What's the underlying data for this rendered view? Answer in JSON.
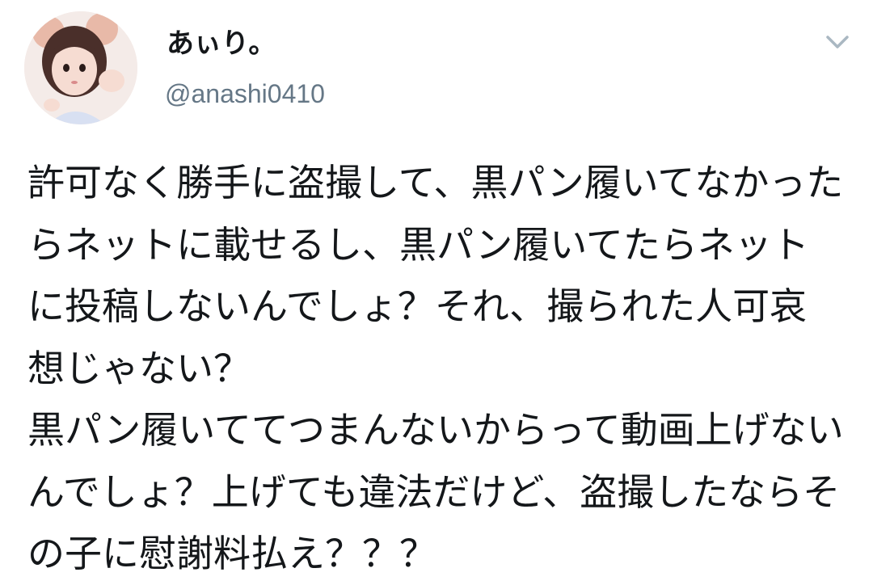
{
  "tweet": {
    "author": {
      "display_name": "あぃり。",
      "handle": "@anashi0410"
    },
    "menu_icon": "chevron-down-icon",
    "text": "許可なく勝手に盗撮して、黒パン履いてなかったらネットに載せるし、黒パン履いてたらネットに投稿しないんでしょ？それ、撮られた人可哀想じゃない？\n黒パン履いててつまんないからって動画上げないんでしょ？上げても違法だけど、盗撮したならその子に慰謝料払え？？？"
  },
  "colors": {
    "text": "#14171a",
    "secondary": "#657786",
    "chevron": "#aab8c2"
  }
}
